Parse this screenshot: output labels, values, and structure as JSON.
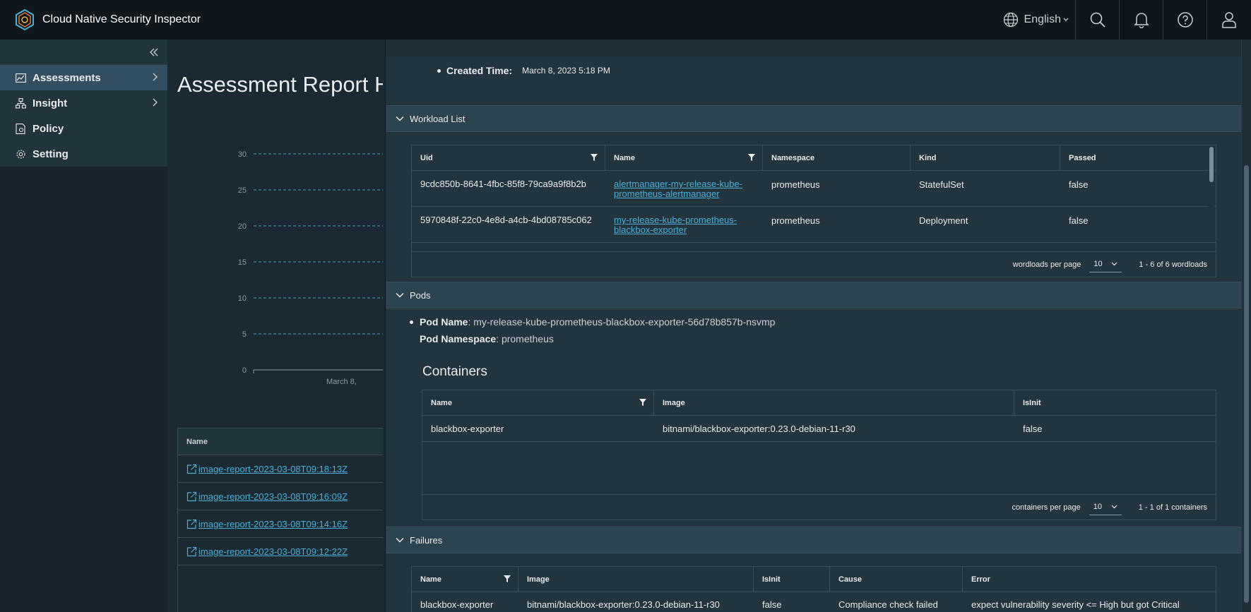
{
  "app": {
    "title": "Cloud Native Security Inspector",
    "language": "English"
  },
  "sidebar": {
    "items": [
      {
        "label": "Assessments",
        "icon": "chart-icon",
        "active": true,
        "has_children": true
      },
      {
        "label": "Insight",
        "icon": "network-icon",
        "active": false,
        "has_children": true
      },
      {
        "label": "Policy",
        "icon": "policy-icon",
        "active": false,
        "has_children": false
      },
      {
        "label": "Setting",
        "icon": "gear-icon",
        "active": false,
        "has_children": false
      }
    ]
  },
  "background_page": {
    "title": "Assessment Report H",
    "chart_data": {
      "type": "line",
      "title": "",
      "yticks": [
        30,
        25,
        20,
        15,
        10,
        5,
        0
      ],
      "xtick": "March 8,",
      "ylim": [
        0,
        30
      ],
      "grid": true
    },
    "table": {
      "header": "Name",
      "rows": [
        "image-report-2023-03-08T09:18:13Z",
        "image-report-2023-03-08T09:16:09Z",
        "image-report-2023-03-08T09:14:16Z",
        "image-report-2023-03-08T09:12:22Z"
      ]
    }
  },
  "detail": {
    "created_label": "Created Time:",
    "created_value": "March 8, 2023 5:18 PM",
    "workload_section": "Workload List",
    "workload_table": {
      "columns": [
        "Uid",
        "Name",
        "Namespace",
        "Kind",
        "Passed"
      ],
      "rows": [
        {
          "uid": "9cdc850b-8641-4fbc-85f8-79ca9a9f8b2b",
          "name": "alertmanager-my-release-kube-prometheus-alertmanager",
          "namespace": "prometheus",
          "kind": "StatefulSet",
          "passed": "false"
        },
        {
          "uid": "5970848f-22c0-4e8d-a4cb-4bd08785c062",
          "name": "my-release-kube-prometheus-blackbox-exporter",
          "namespace": "prometheus",
          "kind": "Deployment",
          "passed": "false"
        }
      ],
      "footer_label": "wordloads per page",
      "page_size": "10",
      "range": "1 - 6 of 6 wordloads"
    },
    "pods_section": "Pods",
    "pod_name_label": "Pod Name",
    "pod_name": ": my-release-kube-prometheus-blackbox-exporter-56d78b857b-nsvmp",
    "pod_ns_label": "Pod Namespace",
    "pod_ns": ": prometheus",
    "containers_title": "Containers",
    "containers_table": {
      "columns": [
        "Name",
        "Image",
        "IsInit"
      ],
      "rows": [
        {
          "name": "blackbox-exporter",
          "image": "bitnami/blackbox-exporter:0.23.0-debian-11-r30",
          "isinit": "false"
        }
      ],
      "footer_label": "containers per page",
      "page_size": "10",
      "range": "1 - 1 of 1 containers"
    },
    "failures_section": "Failures",
    "failures_table": {
      "columns": [
        "Name",
        "Image",
        "IsInit",
        "Cause",
        "Error"
      ],
      "rows": [
        {
          "name": "blackbox-exporter",
          "image": "bitnami/blackbox-exporter:0.23.0-debian-11-r30",
          "isinit": "false",
          "cause": "Compliance check failed",
          "error": "expect vulnerability severity <= High but got Critical"
        }
      ]
    }
  }
}
